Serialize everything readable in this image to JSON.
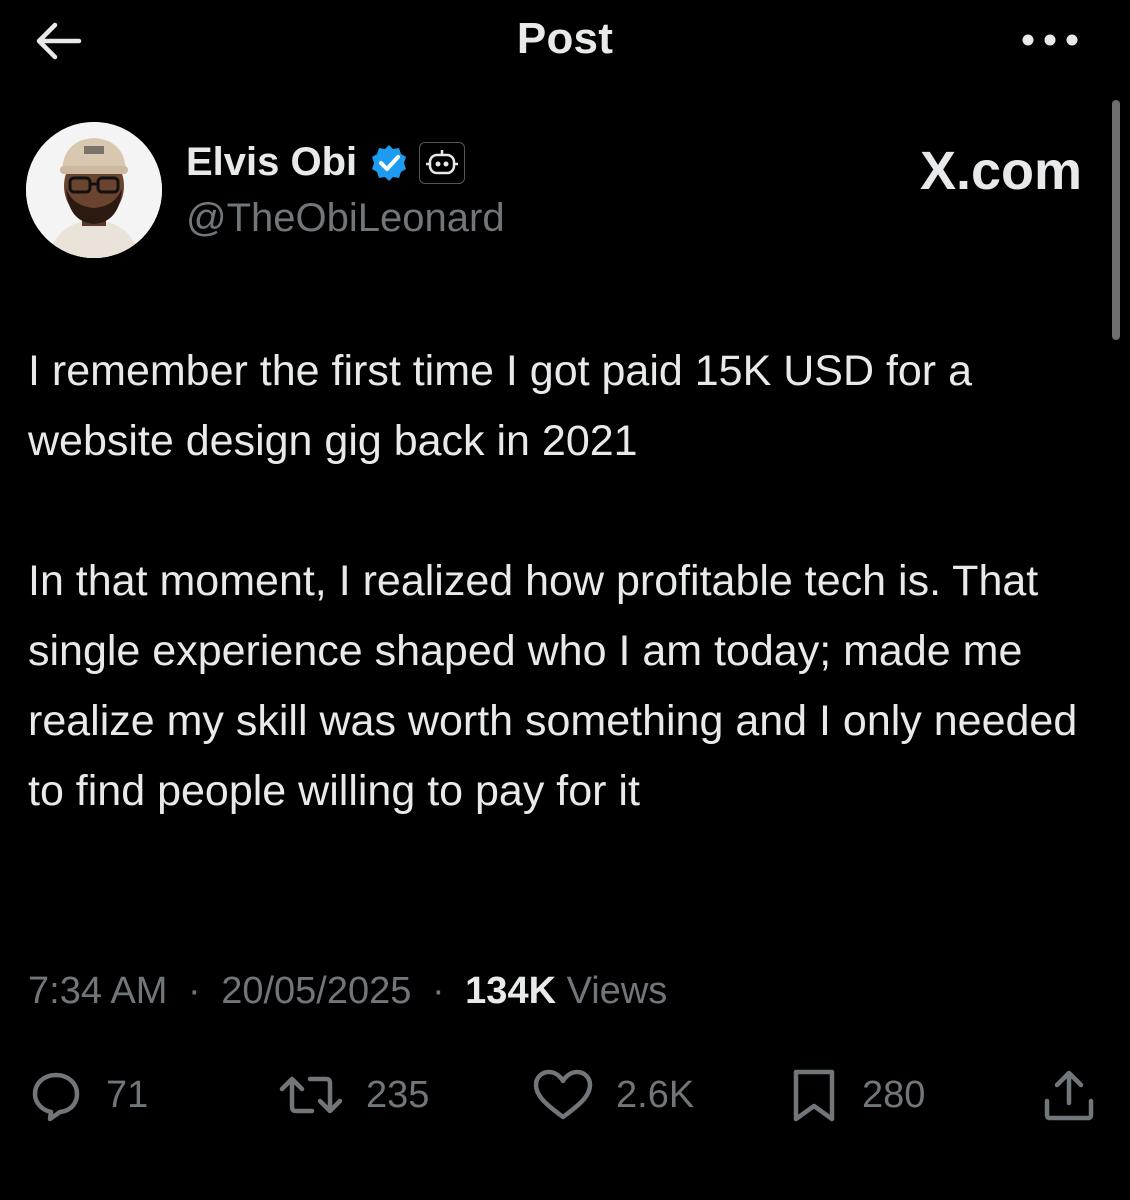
{
  "header": {
    "title": "Post",
    "back_icon": "arrow-left-icon",
    "more_icon": "more-horizontal-icon"
  },
  "post": {
    "author": {
      "name": "Elvis Obi",
      "handle": "@TheObiLeonard",
      "verified": true,
      "badge_icon": "bot-badge-icon"
    },
    "brand": "X.com",
    "body": [
      "I remember the first time I got paid 15K USD for a website design gig back in 2021",
      "In that moment, I realized how profitable tech is. That single experience shaped who I am today; made me realize my skill was worth something and I only needed to find people willing to pay for it"
    ],
    "meta": {
      "time": "7:34 AM",
      "date": "20/05/2025",
      "views_count": "134K",
      "views_label": "Views",
      "separator": "·"
    },
    "actions": {
      "replies": "71",
      "reposts": "235",
      "likes": "2.6K",
      "bookmarks": "280"
    }
  },
  "colors": {
    "background": "#000000",
    "text_primary": "#e7e9ea",
    "text_secondary": "#71767b",
    "verified_blue": "#1d9bf0"
  }
}
